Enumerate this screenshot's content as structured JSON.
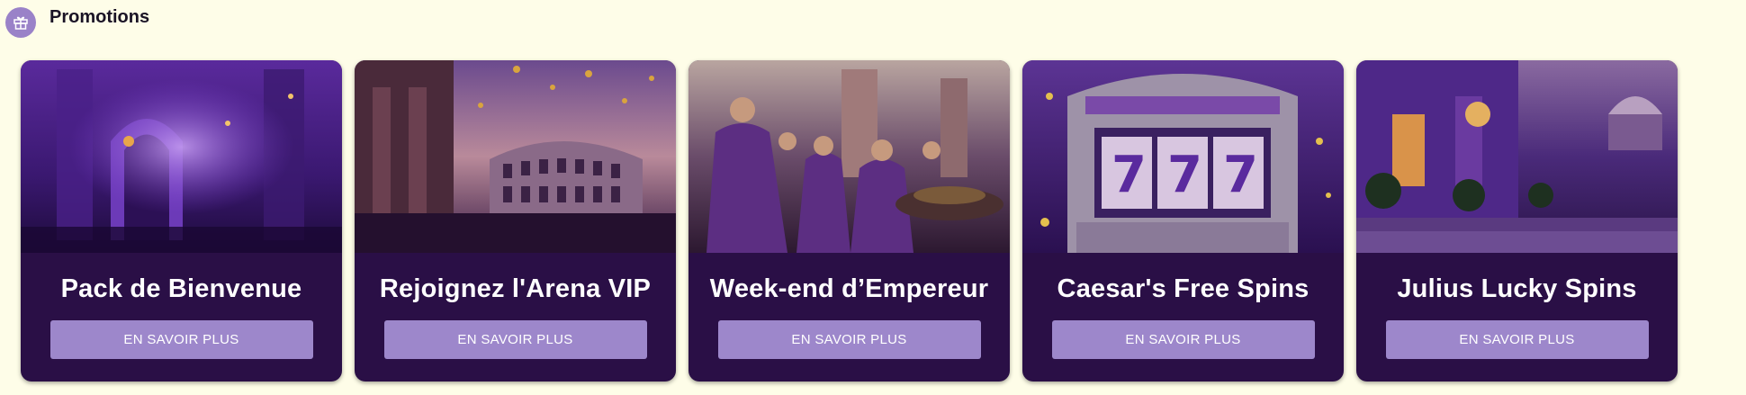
{
  "section": {
    "title": "Promotions",
    "icon": "gift-icon",
    "icon_color": "#9a82c8"
  },
  "colors": {
    "page_background": "#fefde8",
    "card_background": "#2a0f46",
    "button_background": "#9d87cb",
    "title_text": "#ffffff"
  },
  "promotions": [
    {
      "title": "Pack de Bienvenue",
      "button_label": "EN SAVOIR PLUS",
      "image": "purple-palace-interior"
    },
    {
      "title": "Rejoignez l'Arena VIP",
      "button_label": "EN SAVOIR PLUS",
      "image": "colosseum-gold-coins"
    },
    {
      "title": "Week-end d’Empereur",
      "button_label": "EN SAVOIR PLUS",
      "image": "roman-feast-crowd"
    },
    {
      "title": "Caesar's Free Spins",
      "button_label": "EN SAVOIR PLUS",
      "image": "slot-machine-777"
    },
    {
      "title": "Julius Lucky Spins",
      "button_label": "EN SAVOIR PLUS",
      "image": "roman-street-night"
    }
  ]
}
